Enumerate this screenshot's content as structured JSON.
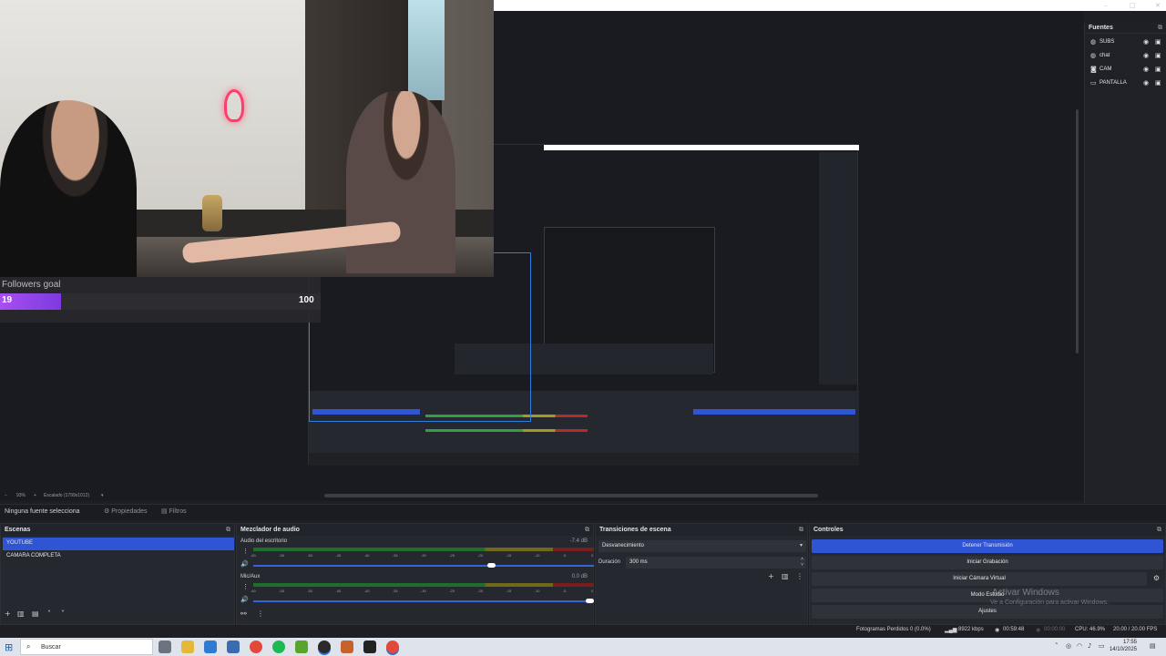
{
  "titlebar": {
    "min": "–",
    "max": "□",
    "close": "✕"
  },
  "goal": {
    "title": "Followers goal",
    "current": "19",
    "max": "100",
    "progress": 0.19,
    "color": "#a74ff2"
  },
  "preview_status": {
    "zoom": "93%",
    "scale": "Escalado (1799x1012)"
  },
  "sources": {
    "title": "Fuentes",
    "items": [
      {
        "name": "SUBS",
        "icon": "browser-icon"
      },
      {
        "name": "chat",
        "icon": "browser-icon"
      },
      {
        "name": "CAM",
        "icon": "camera-icon"
      },
      {
        "name": "PANTALLA",
        "icon": "monitor-icon"
      }
    ]
  },
  "context": {
    "no_source": "Ninguna fuente selecciona",
    "properties": "Propiedades",
    "filters": "Filtros"
  },
  "scenes": {
    "title": "Escenas",
    "items": [
      "YOUTUBE",
      "CAMARA COMPLETA"
    ],
    "selected": 0
  },
  "mixer": {
    "title": "Mezclador de audio",
    "channels": [
      {
        "name": "Audio del escritorio",
        "db": "-7.4 dB",
        "volume": 0.71
      },
      {
        "name": "Mic/Aux",
        "db": "0.0 dB",
        "volume": 1.0
      }
    ],
    "ticks": [
      "-60",
      "-55",
      "-50",
      "-45",
      "-40",
      "-35",
      "-30",
      "-25",
      "-20",
      "-15",
      "-10",
      "-5",
      "0"
    ]
  },
  "transitions": {
    "title": "Transiciones de escena",
    "selected": "Desvanecimiento",
    "duration_label": "Duración",
    "duration": "300 ms"
  },
  "controls": {
    "title": "Controles",
    "buttons": [
      "Detener Transmisión",
      "Iniciar Grabación",
      "Iniciar Cámara Virtual",
      "Modo Estudio",
      "Ajustes"
    ],
    "watermark_title": "Activar Windows",
    "watermark_sub": "Ve a Configuración para activar Windows."
  },
  "status": {
    "dropped": "Fotogramas Perdidos 0 (0.0%)",
    "bitrate": "8922 kbps",
    "stream_time": "00:59:48",
    "rec_time": "00:00:00",
    "cpu": "CPU: 46.9%",
    "fps": "20.00 / 20.00 FPS"
  },
  "taskbar": {
    "search_placeholder": "Buscar",
    "time": "17:55",
    "date": "14/10/2025"
  },
  "colors": {
    "accent": "#2f55d4",
    "goal": "#a74ff2",
    "meter_green": "#2fa043",
    "meter_yellow": "#a59a21",
    "meter_red": "#b32b2b"
  }
}
